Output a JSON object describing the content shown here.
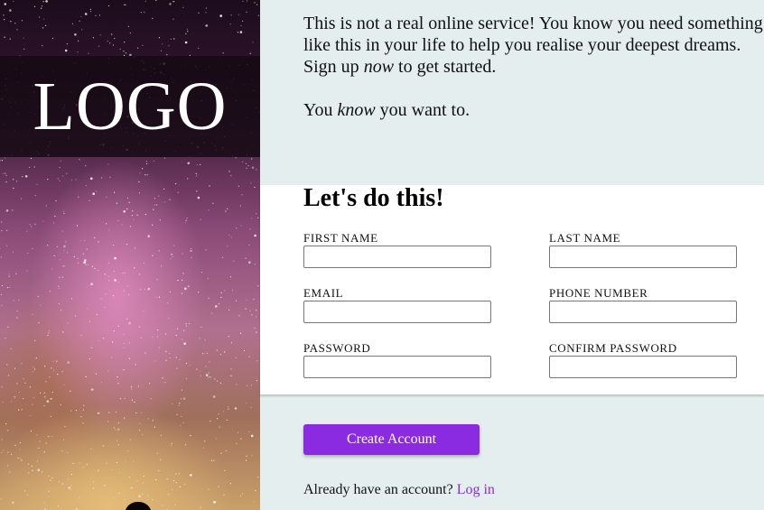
{
  "logo": {
    "text": "LOGO"
  },
  "intro": {
    "line1": "This is not a real online service! You know you need something",
    "line2": "like this in your life to help you realise your deepest dreams.",
    "line3_pre": "Sign up ",
    "line3_em": "now",
    "line3_post": " to get started.",
    "line4_pre": "You ",
    "line4_em": "know",
    "line4_post": " you want to."
  },
  "form": {
    "title": "Let's do this!",
    "fields": {
      "first_name": {
        "label": "FIRST NAME",
        "value": ""
      },
      "last_name": {
        "label": "LAST NAME",
        "value": ""
      },
      "email": {
        "label": "EMAIL",
        "value": ""
      },
      "phone": {
        "label": "PHONE NUMBER",
        "value": ""
      },
      "password": {
        "label": "PASSWORD",
        "value": ""
      },
      "confirm_password": {
        "label": "CONFIRM PASSWORD",
        "value": ""
      }
    }
  },
  "actions": {
    "create_label": "Create Account",
    "login_prompt": "Already have an account? ",
    "login_link": "Log in"
  },
  "colors": {
    "accent": "#8a2be2",
    "page_bg": "#e4eeee",
    "panel_bg": "#ffffff"
  }
}
